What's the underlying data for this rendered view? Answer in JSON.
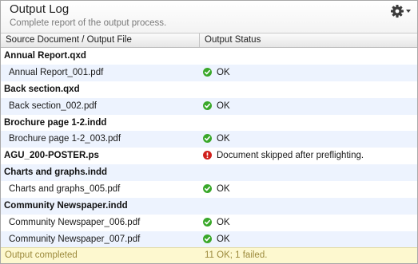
{
  "panel": {
    "title": "Output Log",
    "subtitle": "Complete report of the output process."
  },
  "columns": {
    "source": "Source Document / Output File",
    "status": "Output Status"
  },
  "rows": [
    {
      "type": "group",
      "label": "Annual Report.qxd",
      "status": "",
      "icon": ""
    },
    {
      "type": "file",
      "label": "Annual Report_001.pdf",
      "status": "OK",
      "icon": "check-icon"
    },
    {
      "type": "group",
      "label": "Back section.qxd",
      "status": "",
      "icon": ""
    },
    {
      "type": "file",
      "label": "Back section_002.pdf",
      "status": "OK",
      "icon": "check-icon"
    },
    {
      "type": "group",
      "label": "Brochure page 1-2.indd",
      "status": "",
      "icon": ""
    },
    {
      "type": "file",
      "label": "Brochure page 1-2_003.pdf",
      "status": "OK",
      "icon": "check-icon"
    },
    {
      "type": "group",
      "label": "AGU_200-POSTER.ps",
      "status": "Document skipped after preflighting.",
      "icon": "error-icon"
    },
    {
      "type": "group",
      "label": "Charts and graphs.indd",
      "status": "",
      "icon": ""
    },
    {
      "type": "file",
      "label": "Charts and graphs_005.pdf",
      "status": "OK",
      "icon": "check-icon"
    },
    {
      "type": "group",
      "label": "Community Newspaper.indd",
      "status": "",
      "icon": ""
    },
    {
      "type": "file",
      "label": "Community Newspaper_006.pdf",
      "status": "OK",
      "icon": "check-icon"
    },
    {
      "type": "file",
      "label": "Community Newspaper_007.pdf",
      "status": "OK",
      "icon": "check-icon"
    }
  ],
  "footer": {
    "label": "Output completed",
    "summary": "11 OK; 1 failed."
  },
  "colors": {
    "ok": "#3aa82a",
    "error": "#d0201c",
    "row_alt": "#edf3fe",
    "footer_bg": "#fdf8cf"
  }
}
